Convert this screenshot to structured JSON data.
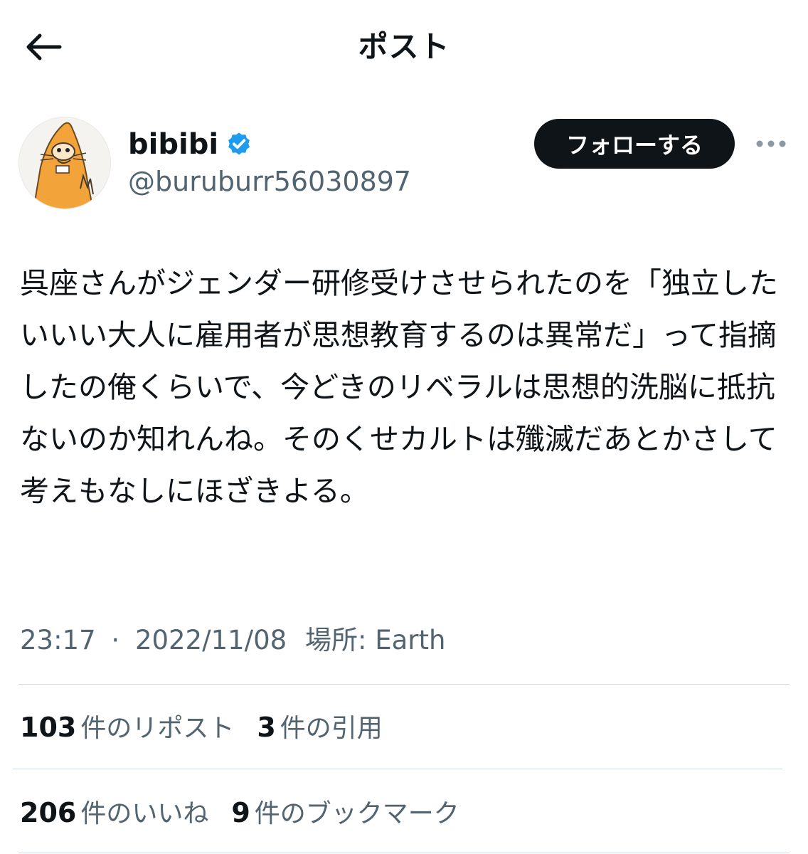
{
  "header": {
    "title": "ポスト",
    "back_icon": "arrow-left-icon"
  },
  "author": {
    "display_name": "bibibi",
    "handle": "@buruburr56030897",
    "verified": true,
    "verified_icon": "verified-badge-icon",
    "verified_color": "#1d9bf0"
  },
  "actions": {
    "follow_label": "フォローする",
    "more_icon": "more-horizontal-icon"
  },
  "post": {
    "text": "呉座さんがジェンダー研修受けさせられたのを「独立したいいい大人に雇用者が思想教育するのは異常だ」って指摘したの俺くらいで、今どきのリベラルは思想的洗脳に抵抗ないのか知れんね。そのくせカルトは殲滅だあとかさして考えもなしにほざきよる。",
    "time": "23:17",
    "separator": "·",
    "date": "2022/11/08",
    "location": "場所: Earth"
  },
  "stats": {
    "reposts": {
      "count": "103",
      "label": "件のリポスト"
    },
    "quotes": {
      "count": "3",
      "label": "件の引用"
    },
    "likes": {
      "count": "206",
      "label": "件のいいね"
    },
    "bookmarks": {
      "count": "9",
      "label": "件のブックマーク"
    }
  },
  "colors": {
    "text_primary": "#0f1419",
    "text_secondary": "#536471",
    "divider": "#cfd9de",
    "follow_bg": "#0f1419",
    "follow_text": "#ffffff"
  }
}
